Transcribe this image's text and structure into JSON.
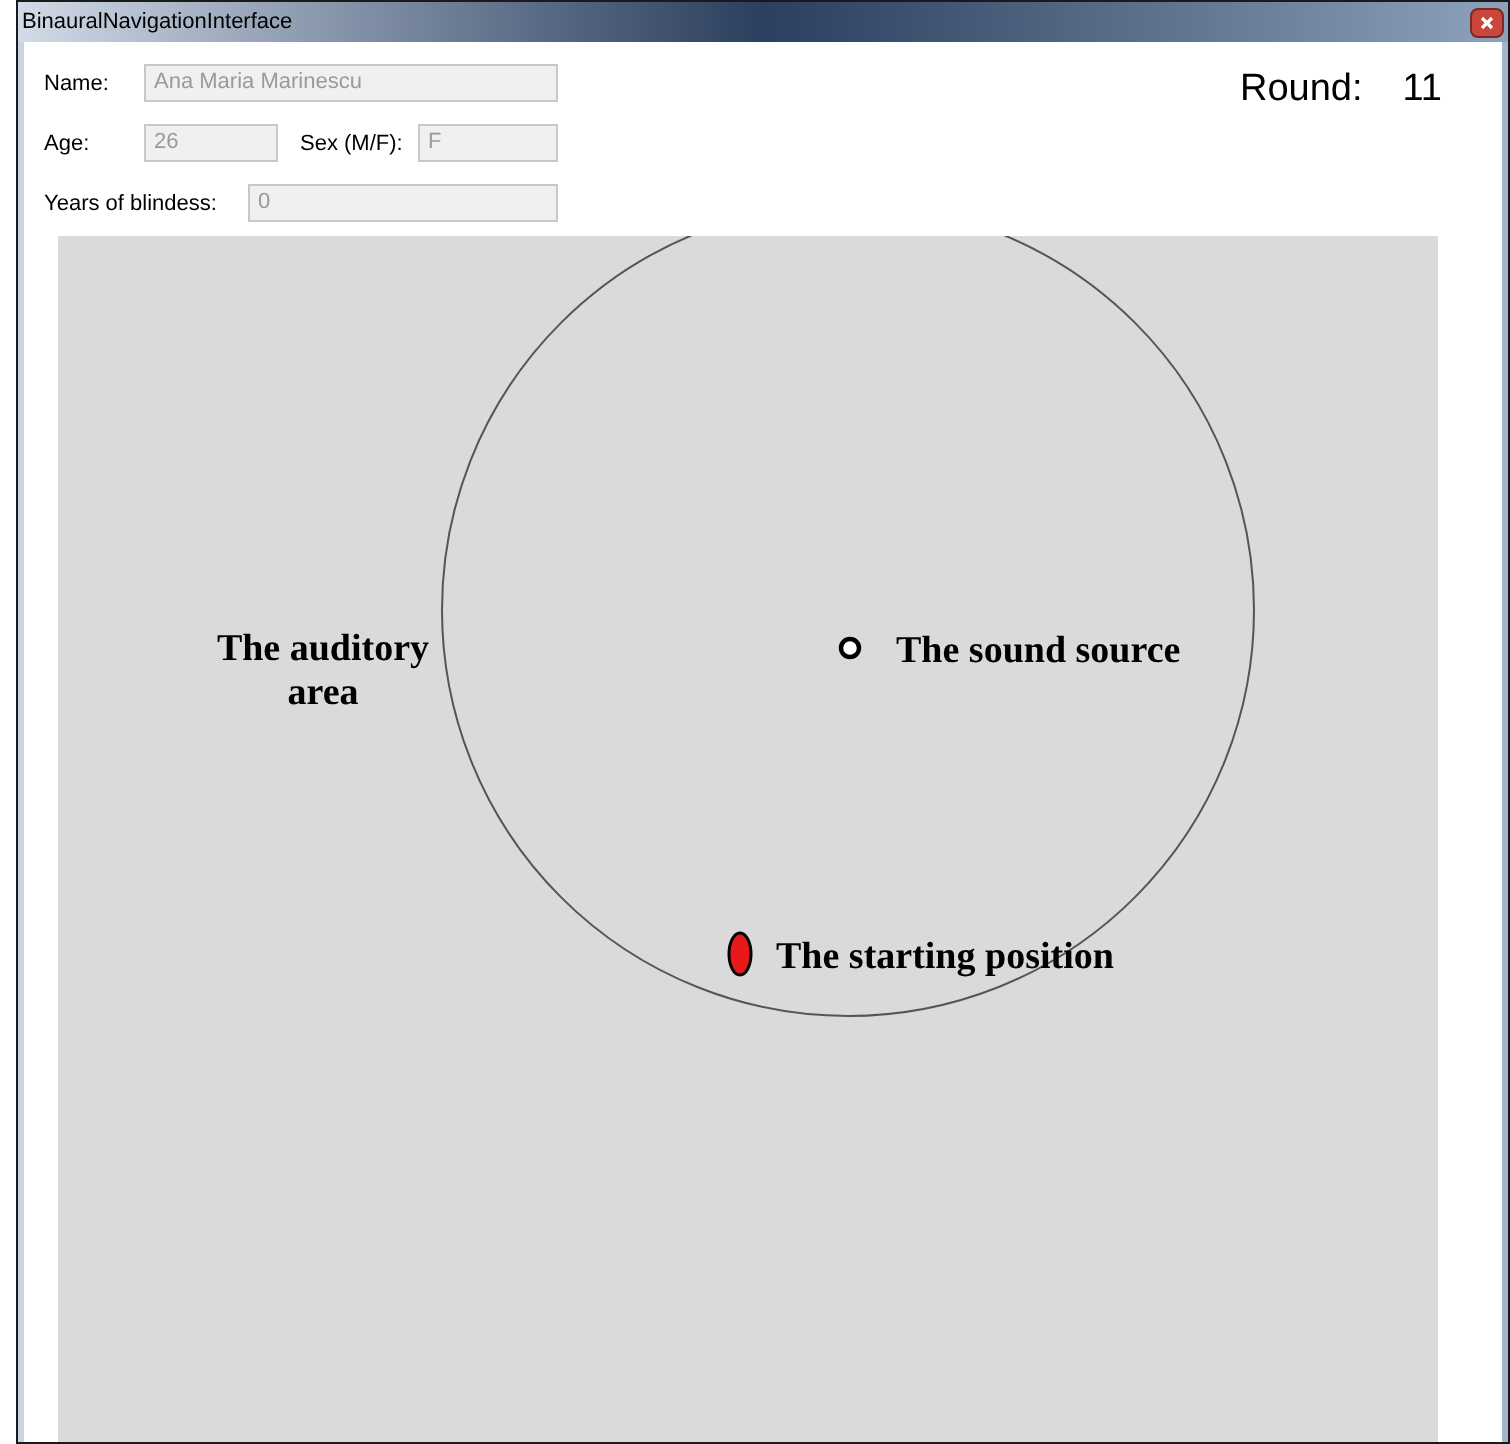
{
  "window": {
    "title": "BinauralNavigationInterface"
  },
  "fields": [
    {
      "label": "Name:",
      "value": "Ana Maria Marinescu",
      "disabled": true
    },
    {
      "label": "Age:",
      "value": "26",
      "disabled": true
    },
    {
      "label": "Sex (M/F):",
      "value": "F",
      "disabled": true
    },
    {
      "label": "Years of blindess:",
      "value": "0",
      "disabled": true
    }
  ],
  "round": {
    "label": "Round:",
    "value": "11"
  },
  "arena": {
    "area_label": "The auditory area",
    "source_label": "The sound source",
    "start_label": "The starting position"
  }
}
